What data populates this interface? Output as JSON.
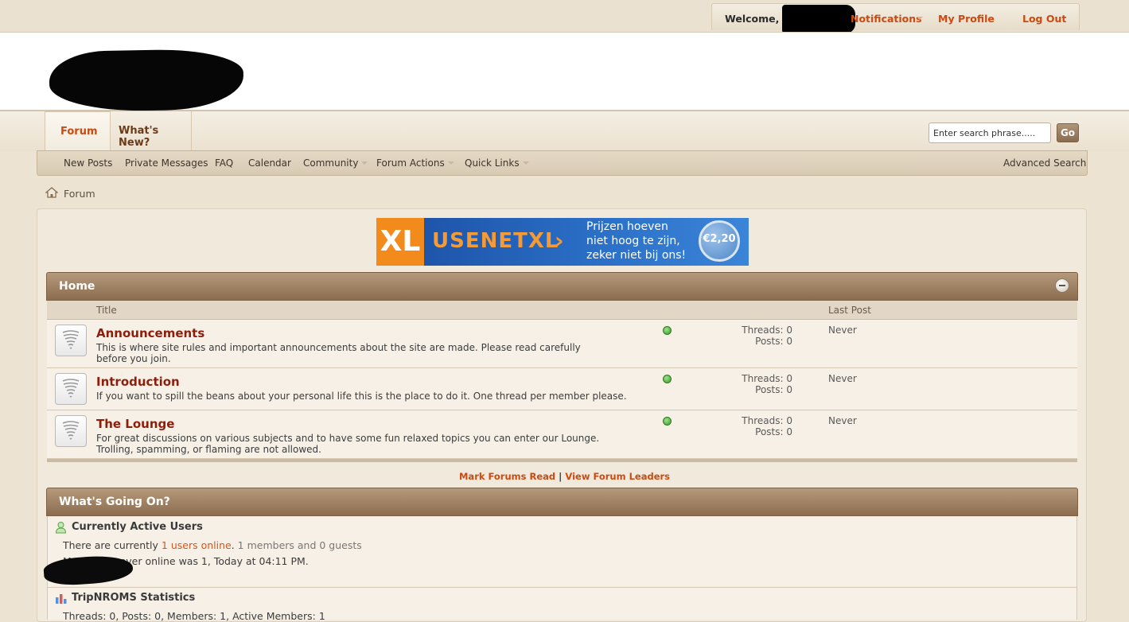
{
  "topbar": {
    "welcome": "Welcome,",
    "notifications": "Notifications",
    "my_profile": "My Profile",
    "log_out": "Log Out"
  },
  "nav": {
    "tab_forum": "Forum",
    "tab_whats_new": "What's New?",
    "search_placeholder": "Enter search phrase.....",
    "go": "Go",
    "sub": {
      "new_posts": "New Posts",
      "private_messages": "Private Messages",
      "faq": "FAQ",
      "calendar": "Calendar",
      "community": "Community",
      "forum_actions": "Forum Actions",
      "quick_links": "Quick Links",
      "advanced_search": "Advanced Search"
    }
  },
  "breadcrumb": {
    "forum": "Forum"
  },
  "banner": {
    "xl": "XL",
    "brand": "USENETXL",
    "arrow": "›",
    "line1": "Prijzen hoeven",
    "line2": "niet hoog te zijn,",
    "line3": "zeker niet bij ons!",
    "price": "€2,20"
  },
  "home_block": {
    "title": "Home",
    "col_title": "Title",
    "col_last_post": "Last Post",
    "forums": [
      {
        "title": "Announcements",
        "desc": "This is where site rules and important announcements about the site are made. Please read carefully before you join.",
        "threads": "Threads: 0",
        "posts": "Posts: 0",
        "last_post": "Never"
      },
      {
        "title": "Introduction",
        "desc": "If you want to spill the beans about your personal life this is the place to do it. One thread per member please.",
        "threads": "Threads: 0",
        "posts": "Posts: 0",
        "last_post": "Never"
      },
      {
        "title": "The Lounge",
        "desc": "For great discussions on various subjects and to have some fun relaxed topics you can enter our Lounge. Trolling, spamming, or flaming are not allowed.",
        "threads": "Threads: 0",
        "posts": "Posts: 0",
        "last_post": "Never"
      }
    ]
  },
  "footer_links": {
    "mark_read": "Mark Forums Read",
    "separator": "|",
    "leaders": "View Forum Leaders"
  },
  "wgo": {
    "title": "What's Going On?",
    "active_users_head": "Currently Active Users",
    "online_prefix": "There are currently ",
    "online_link": "1 users online",
    "online_suffix": ". ",
    "online_detail": "1 members and 0 guests",
    "most_users": "Most users ever online was 1, Today at 04:11 PM.",
    "stats_head": "TripNROMS Statistics",
    "stats_line": "Threads: 0, Posts: 0, Members: 1, Active Members: 1"
  }
}
